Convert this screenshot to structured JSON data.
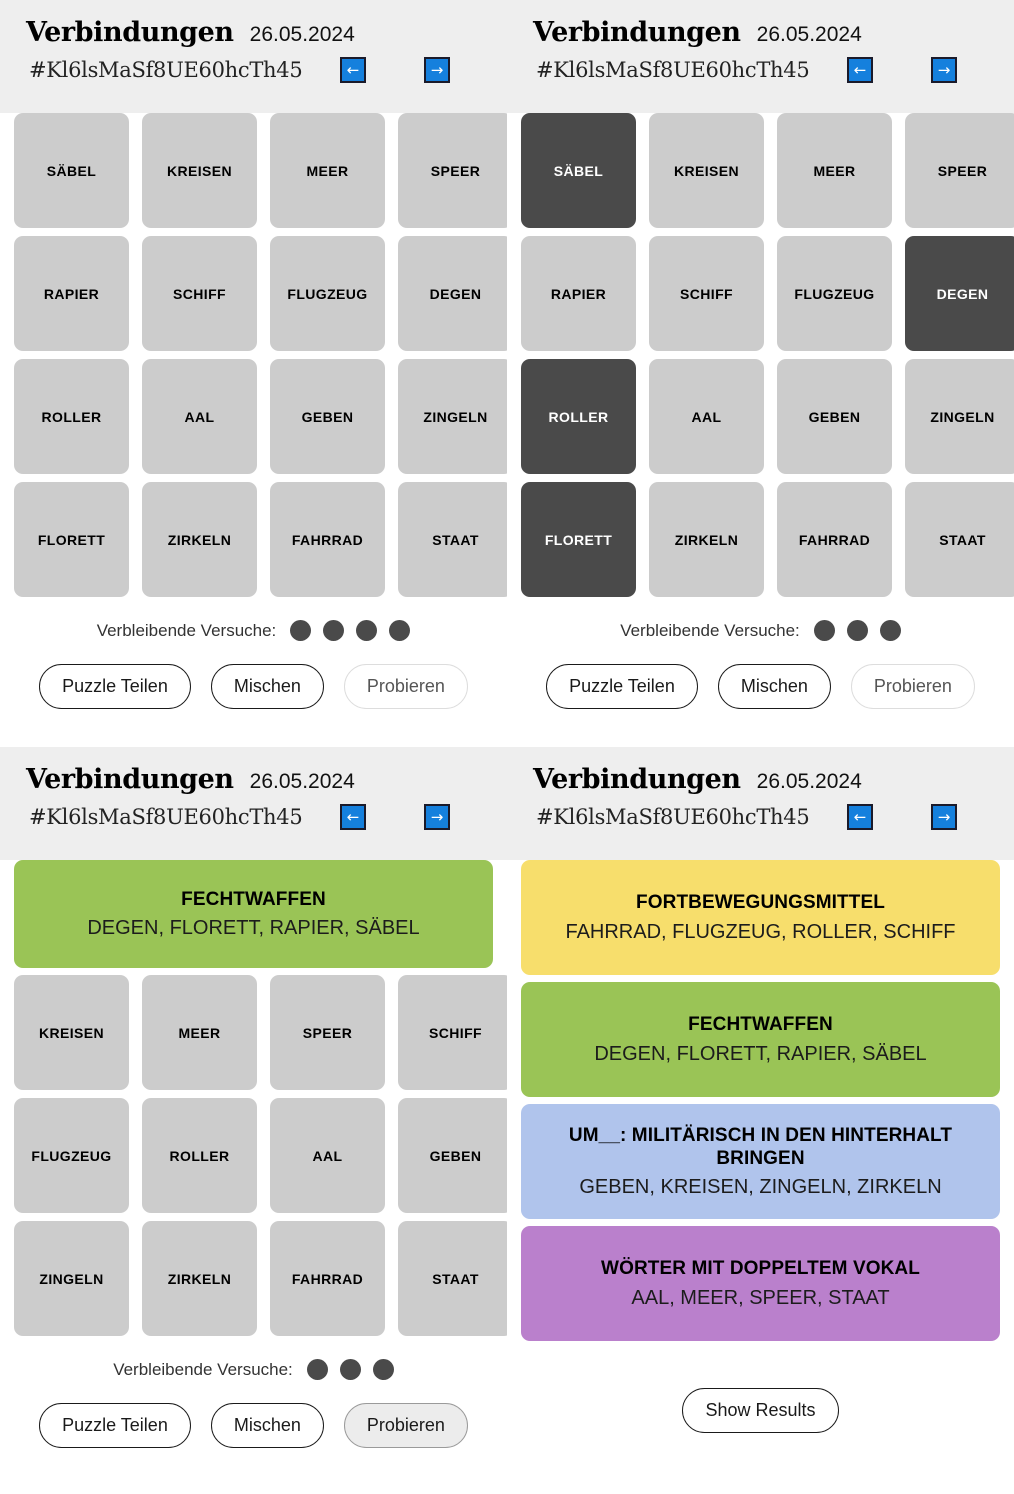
{
  "header": {
    "title": "Verbindungen",
    "date": "26.05.2024",
    "hash": "#Kl6lsMaSf8UE60hcTh45",
    "prev_label": "←",
    "next_label": "→"
  },
  "labels": {
    "attempts": "Verbleibende Versuche:",
    "share": "Puzzle Teilen",
    "shuffle": "Mischen",
    "submit": "Probieren",
    "show_results": "Show Results"
  },
  "colors": {
    "tile": "#cccccc",
    "tile_selected": "#4a4a4a",
    "header_bg": "#eeeeee",
    "nav_button": "#1580dd",
    "category_yellow": "#f7de6c",
    "category_green": "#9ac456",
    "category_blue": "#b0c4ec",
    "category_purple": "#ba80cc"
  },
  "categories": {
    "fechtwaffen": {
      "title": "FECHTWAFFEN",
      "words": "DEGEN, FLORETT, RAPIER, SÄBEL"
    },
    "fortbewegungsmittel": {
      "title": "FORTBEWEGUNGSMITTEL",
      "words": "FAHRRAD, FLUGZEUG, ROLLER, SCHIFF"
    },
    "hinterhalt": {
      "title": "UM__: MILITÄRISCH IN DEN HINTERHALT BRINGEN",
      "words": "GEBEN, KREISEN, ZINGELN, ZIRKELN"
    },
    "doppelvokal": {
      "title": "WÖRTER MIT DOPPELTEM VOKAL",
      "words": "AAL, MEER, SPEER, STAAT"
    }
  },
  "panel1": {
    "tiles": [
      "SÄBEL",
      "KREISEN",
      "MEER",
      "SPEER",
      "RAPIER",
      "SCHIFF",
      "FLUGZEUG",
      "DEGEN",
      "ROLLER",
      "AAL",
      "GEBEN",
      "ZINGELN",
      "FLORETT",
      "ZIRKELN",
      "FAHRRAD",
      "STAAT"
    ],
    "selected": [],
    "attempts_remaining": 4,
    "submit_state": "muted"
  },
  "panel2": {
    "tiles": [
      "SÄBEL",
      "KREISEN",
      "MEER",
      "SPEER",
      "RAPIER",
      "SCHIFF",
      "FLUGZEUG",
      "DEGEN",
      "ROLLER",
      "AAL",
      "GEBEN",
      "ZINGELN",
      "FLORETT",
      "ZIRKELN",
      "FAHRRAD",
      "STAAT"
    ],
    "selected": [
      0,
      7,
      8,
      12
    ],
    "attempts_remaining": 3,
    "submit_state": "muted"
  },
  "panel3": {
    "solved": [
      "fechtwaffen"
    ],
    "tiles": [
      "KREISEN",
      "MEER",
      "SPEER",
      "SCHIFF",
      "FLUGZEUG",
      "ROLLER",
      "AAL",
      "GEBEN",
      "ZINGELN",
      "ZIRKELN",
      "FAHRRAD",
      "STAAT"
    ],
    "selected": [],
    "attempts_remaining": 3,
    "submit_state": "active"
  },
  "panel4": {
    "solved": [
      "fortbewegungsmittel",
      "fechtwaffen",
      "hinterhalt",
      "doppelvokal"
    ]
  }
}
